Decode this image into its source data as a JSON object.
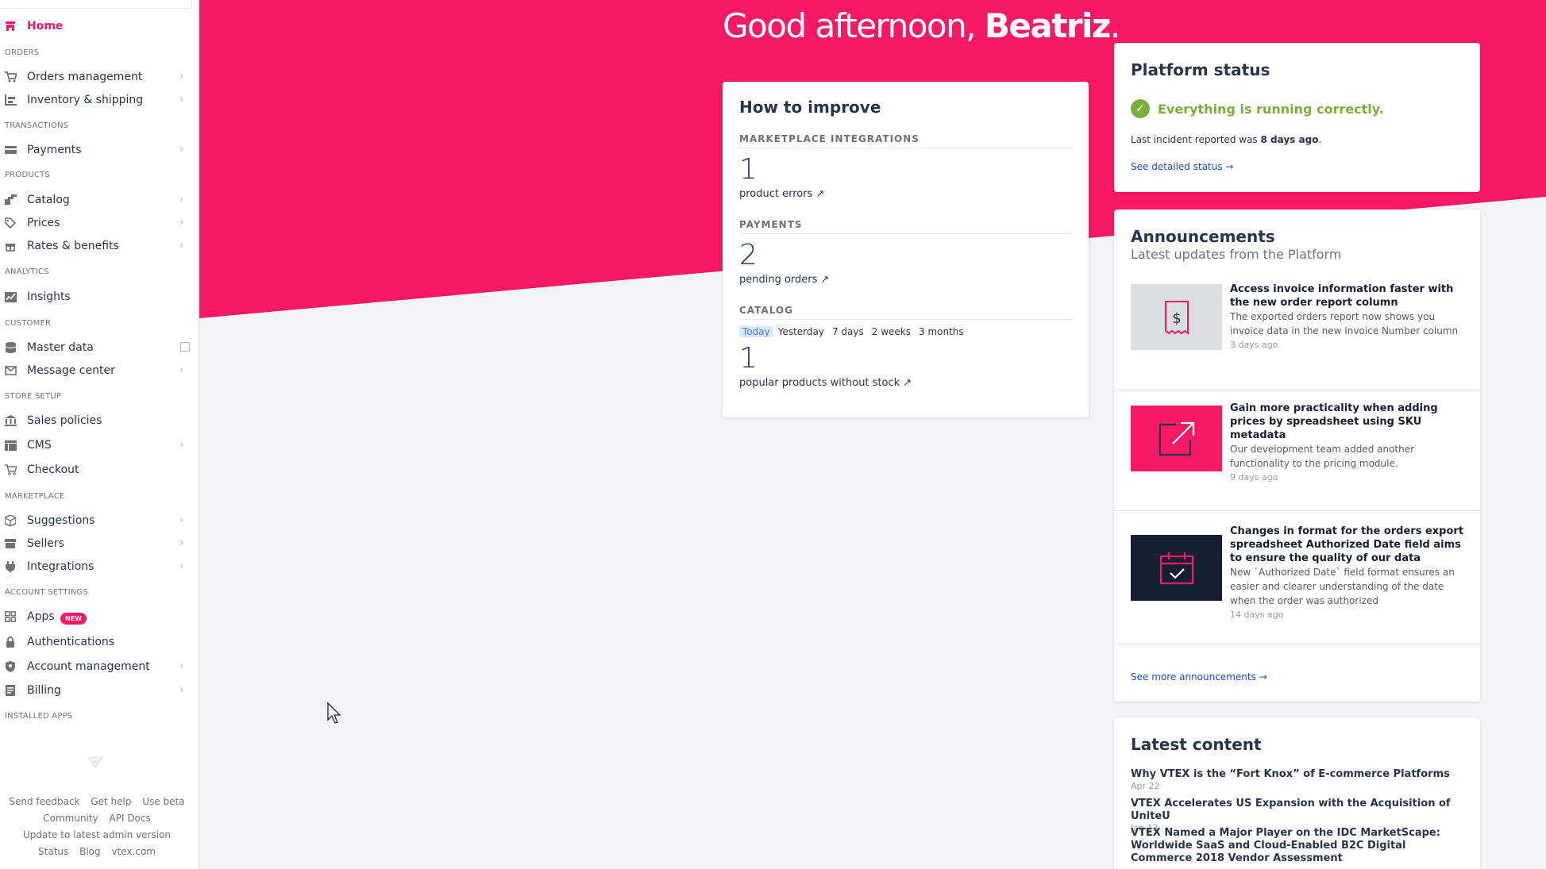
{
  "colors": {
    "brand": "#f71963",
    "success": "#79b03a",
    "link": "#134cd8",
    "text": "#25354d"
  },
  "sidebar": {
    "home": "Home",
    "sections": {
      "orders": "ORDERS",
      "transactions": "TRANSACTIONS",
      "products": "PRODUCTS",
      "analytics": "ANALYTICS",
      "customer": "CUSTOMER",
      "store_setup": "STORE SETUP",
      "marketplace": "MARKETPLACE",
      "account_settings": "ACCOUNT SETTINGS",
      "installed_apps": "INSTALLED APPS"
    },
    "items": {
      "orders_management": "Orders management",
      "inventory_shipping": "Inventory & shipping",
      "payments": "Payments",
      "catalog": "Catalog",
      "prices": "Prices",
      "rates_benefits": "Rates & benefits",
      "insights": "Insights",
      "master_data": "Master data",
      "message_center": "Message center",
      "sales_policies": "Sales policies",
      "cms": "CMS",
      "checkout": "Checkout",
      "suggestions": "Suggestions",
      "sellers": "Sellers",
      "integrations": "Integrations",
      "apps": "Apps",
      "authentications": "Authentications",
      "account_management": "Account management",
      "billing": "Billing"
    },
    "apps_badge": "NEW",
    "footer": {
      "send_feedback": "Send feedback",
      "get_help": "Get help",
      "use_beta": "Use beta",
      "community": "Community",
      "api_docs": "API Docs",
      "update": "Update to latest admin version",
      "status": "Status",
      "blog": "Blog",
      "vtex": "vtex.com"
    }
  },
  "greeting": {
    "prefix": "Good afternoon, ",
    "name": "Beatriz",
    "suffix": "."
  },
  "improve": {
    "title": "How to improve",
    "marketplace": {
      "title": "MARKETPLACE INTEGRATIONS",
      "value": "1",
      "label": "product errors ↗"
    },
    "payments": {
      "title": "PAYMENTS",
      "value": "2",
      "label": "pending orders ↗"
    },
    "catalog": {
      "title": "CATALOG",
      "ranges": [
        "Today",
        "Yesterday",
        "7 days",
        "2 weeks",
        "3 months"
      ],
      "value": "1",
      "label": "popular products without stock ↗"
    }
  },
  "status": {
    "title": "Platform status",
    "message": "Everything is running correctly.",
    "incident_prefix": "Last incident reported was ",
    "incident_value": "8 days ago",
    "incident_suffix": ".",
    "link": "See detailed status →"
  },
  "announcements": {
    "title": "Announcements",
    "subtitle": "Latest updates from the Platform",
    "items": [
      {
        "title": "Access invoice information faster with the new order report column",
        "desc": "The exported orders report now shows you invoice data in the new Invoice Number column",
        "age": "3 days ago",
        "icon": "invoice-dollar-icon"
      },
      {
        "title": "Gain more practicality when adding prices by spreadsheet using SKU metadata",
        "desc": "Our development team added another functionality to the pricing module.",
        "age": "9 days ago",
        "icon": "external-arrow-icon"
      },
      {
        "title": "Changes in format for the orders export spreadsheet Authorized Date field aims to ensure the quality of our data",
        "desc": "New `Authorized Date` field format ensures an easier and clearer understanding of the date when the order was authorized",
        "age": "14 days ago",
        "icon": "calendar-check-icon"
      }
    ],
    "more": "See more announcements →"
  },
  "latest": {
    "title": "Latest content",
    "items": [
      {
        "title": "Why VTEX is the “Fort Knox” of E-commerce Platforms",
        "date": "Apr 22"
      },
      {
        "title": "VTEX Accelerates US Expansion with the Acquisition of UniteU",
        "date": "Jan 13"
      },
      {
        "title": "VTEX Named a Major Player on the IDC MarketScape: Worldwide SaaS and Cloud-Enabled B2C Digital Commerce 2018 Vendor Assessment",
        "date": ""
      }
    ]
  }
}
